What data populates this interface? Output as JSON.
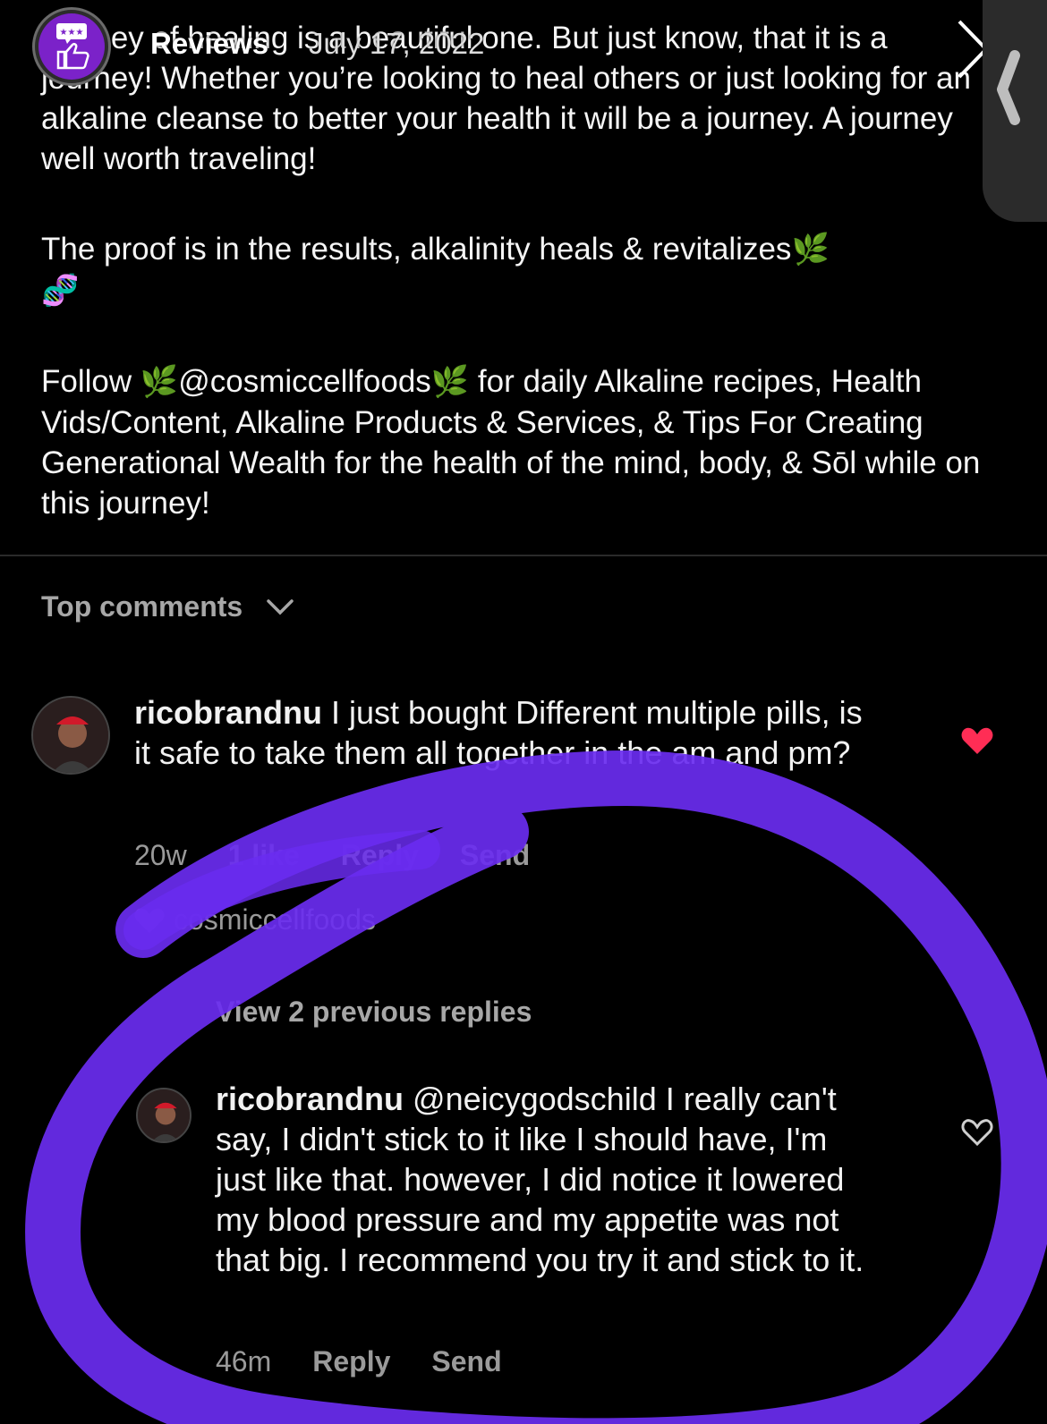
{
  "header": {
    "title": "Reviews",
    "date": "July 17, 2022"
  },
  "caption": {
    "paragraph1": "journey of healing is a beautiful one. But just know, that it is a journey! Whether you’re looking to heal others or just looking for an alkaline cleanse to better your health it will be a journey. A journey well worth traveling!",
    "paragraph2": "The proof is in the results, alkalinity heals & revitalizes",
    "paragraph3_start": "Follow",
    "paragraph3_mention": "@cosmiccellfoods",
    "paragraph3_end": "for daily Alkaline recipes, Health Vids/Content, Alkaline Products & Services, & Tips For Creating Generational Wealth for the health of the mind, body, & Sōl while on this journey!"
  },
  "comments_section": {
    "heading": "Top comments"
  },
  "comment1": {
    "username": "ricobrandnu",
    "text": "I just bought  Different multiple pills, is it safe to take them all together in the am and pm?",
    "time": "20w",
    "likes": "1 like",
    "reply_label": "Reply",
    "send_label": "Send",
    "liked_by": "cosmiccellfoods",
    "heart_color": "#ff2d55"
  },
  "replies": {
    "view_previous": "View 2 previous replies"
  },
  "comment2": {
    "username": "ricobrandnu",
    "mention": "@neicygodschild",
    "text": "I really can't say, I didn't stick to it like I should have, I'm just like that.  however, I did notice it lowered my blood pressure and my appetite was not that big. I recommend you try it and stick to it.",
    "time": "46m",
    "reply_label": "Reply",
    "send_label": "Send"
  },
  "colors": {
    "background": "#000000",
    "scribble": "#6a2cf0",
    "story_avatar": "#7b22c9"
  },
  "icons": [
    "thumbs-up-review-icon",
    "close-icon",
    "chevron-down-icon",
    "heart-filled-icon",
    "heart-outline-icon",
    "leaf-emoji-icon",
    "dna-emoji-icon"
  ]
}
